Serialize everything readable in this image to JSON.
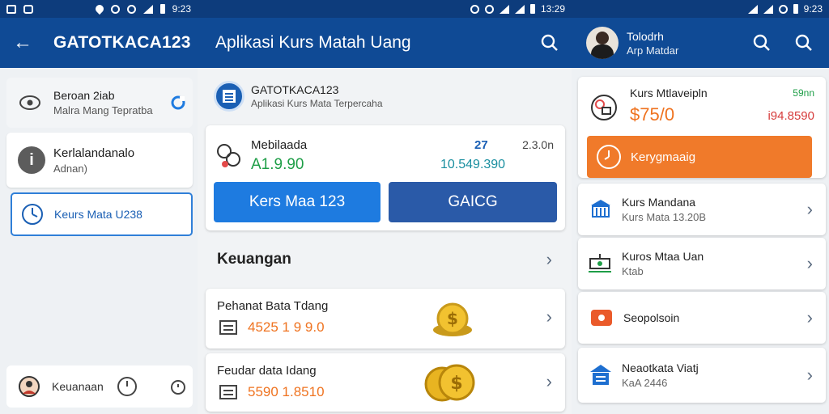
{
  "status": {
    "time_left": "9:23",
    "time_mid": "13:29",
    "time_right": "9:23"
  },
  "panel1": {
    "title": "GATOTKACA123",
    "items": [
      {
        "title": "Beroan 2iab",
        "subtitle": "Malra Mang Tepratba"
      },
      {
        "title": "Kerlalandanalo",
        "subtitle": "Adnan)"
      },
      {
        "title": "Keurs Mata U238"
      }
    ],
    "bottom_label": "Keuanaan"
  },
  "panel2": {
    "title": "Aplikasi Kurs Matah Uang",
    "brand_name": "GATOTKACA123",
    "brand_tagline": "Aplikasi Kurs Mata Terpercaha",
    "rate_card": {
      "label": "Mebilaada",
      "value_left": "A1.9.90",
      "top_mid": "27",
      "top_right": "2.3.0n",
      "value_right": "10.549.390"
    },
    "buttons": {
      "primary": "Kers Maa 123",
      "secondary": "GAICG"
    },
    "section_title": "Keuangan",
    "list": [
      {
        "title": "Pehanat Bata Tdang",
        "amount": "4525 1 9 9.0"
      },
      {
        "title": "Feudar data Idang",
        "amount": "5590 1.8510"
      }
    ],
    "colors": {
      "accent_blue": "#1e7be0",
      "navy": "#2a5aa8",
      "green": "#1e9e47",
      "orange": "#ef7320"
    }
  },
  "panel3": {
    "user_name": "Tolodrh",
    "user_sub": "Arp Matdar",
    "kurs_card": {
      "title": "Kurs Mtlaveipln",
      "value": "$75/0",
      "small_green": "59nn",
      "small_red": "i94.8590"
    },
    "orange_button": "Kerygmaaig",
    "rows": [
      {
        "title": "Kurs Mandana",
        "subtitle": "Kurs Mata 13.20B"
      },
      {
        "title": "Kuros Mtaa Uan",
        "subtitle": "Ktab"
      },
      {
        "title": "Seopolsoin"
      },
      {
        "title": "Neaotkata Viatj",
        "subtitle": "KaA 2446"
      }
    ]
  }
}
